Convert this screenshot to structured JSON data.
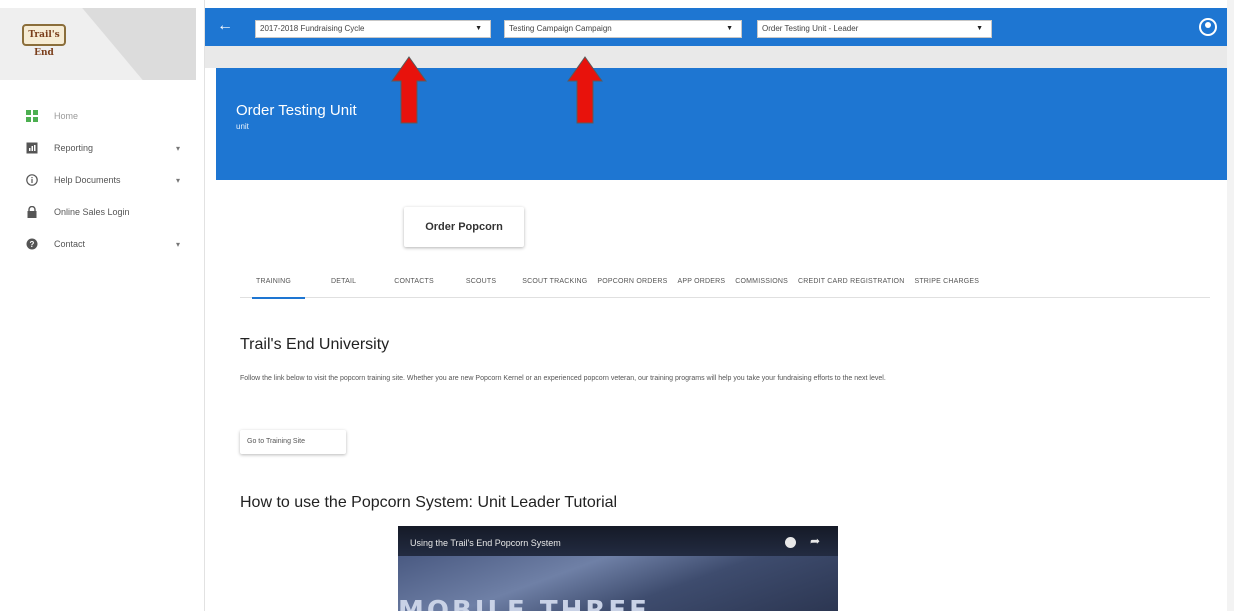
{
  "brand": {
    "logo_text": "Trail's End"
  },
  "sidebar": {
    "items": [
      {
        "label": "Home",
        "icon": "grid-icon",
        "has_chevron": false
      },
      {
        "label": "Reporting",
        "icon": "report-icon",
        "has_chevron": true
      },
      {
        "label": "Help Documents",
        "icon": "info-icon",
        "has_chevron": true
      },
      {
        "label": "Online Sales Login",
        "icon": "lock-icon",
        "has_chevron": false
      },
      {
        "label": "Contact",
        "icon": "help-icon",
        "has_chevron": true
      }
    ]
  },
  "topbar": {
    "fundraising_cycle": "2017-2018 Fundraising Cycle",
    "campaign": "Testing Campaign Campaign",
    "unit": "Order Testing Unit - Leader"
  },
  "header": {
    "title": "Order Testing Unit",
    "subtitle": "unit"
  },
  "order_button": "Order Popcorn",
  "tabs": [
    "TRAINING",
    "DETAIL",
    "CONTACTS",
    "SCOUTS",
    "SCOUT TRACKING",
    "POPCORN ORDERS",
    "APP ORDERS",
    "COMMISSIONS",
    "CREDIT CARD REGISTRATION",
    "STRIPE CHARGES"
  ],
  "training": {
    "heading": "Trail's End University",
    "body": "Follow the link below to visit the popcorn training site. Whether you are new Popcorn Kernel or an experienced popcorn veteran, our training programs will help you take your fundraising efforts to the next level.",
    "button": "Go to Training Site"
  },
  "video_section": {
    "heading": "How to use the Popcorn System: Unit Leader Tutorial",
    "video_title": "Using the Trail's End Popcorn System",
    "video_overlay_text": "MOBILE THREE"
  },
  "colors": {
    "primary": "#1e76d2",
    "annotation_arrow": "#e8120c"
  }
}
